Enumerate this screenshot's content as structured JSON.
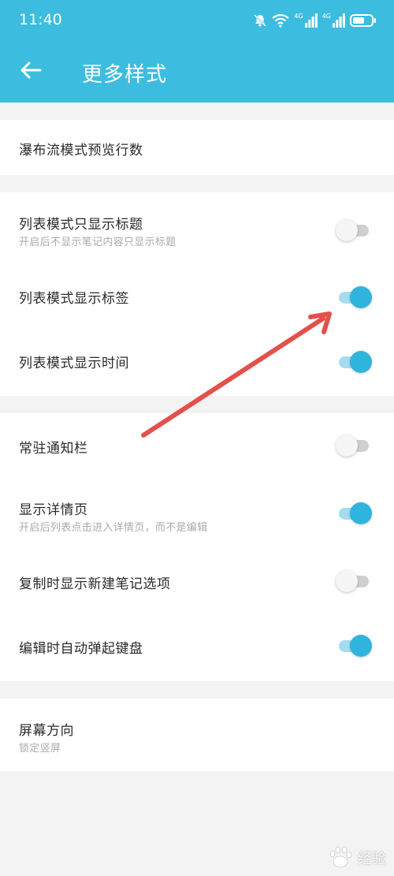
{
  "status_bar": {
    "time": "11:40",
    "icons": [
      "mute-bell-icon",
      "wifi-icon",
      "signal-4g-icon",
      "signal-4g-icon",
      "battery-icon"
    ],
    "signal_label": "4G"
  },
  "toolbar": {
    "back_icon": "arrow-left-icon",
    "title": "更多样式"
  },
  "sections": [
    {
      "items": [
        {
          "title": "瀑布流模式预览行数"
        }
      ]
    },
    {
      "items": [
        {
          "title": "列表模式只显示标题",
          "subtitle": "开启后不显示笔记内容只显示标题",
          "toggle": false
        },
        {
          "title": "列表模式显示标签",
          "toggle": true
        },
        {
          "title": "列表模式显示时间",
          "toggle": true
        }
      ]
    },
    {
      "items": [
        {
          "title": "常驻通知栏",
          "toggle": false
        },
        {
          "title": "显示详情页",
          "subtitle": "开启后列表点击进入详情页，而不是编辑",
          "toggle": true
        },
        {
          "title": "复制时显示新建笔记选项",
          "toggle": false
        },
        {
          "title": "编辑时自动弹起键盘",
          "toggle": true
        }
      ]
    },
    {
      "items": [
        {
          "title": "屏幕方向",
          "subtitle": "锁定竖屏"
        }
      ]
    }
  ],
  "colors": {
    "accent": "#3cbde0",
    "toggle_on_knob": "#2fb5dd",
    "toggle_on_track": "#a5dcef",
    "annotation_arrow": "#e2514c"
  },
  "watermark": {
    "text": "经验",
    "logo": "baidu-paw-logo"
  }
}
